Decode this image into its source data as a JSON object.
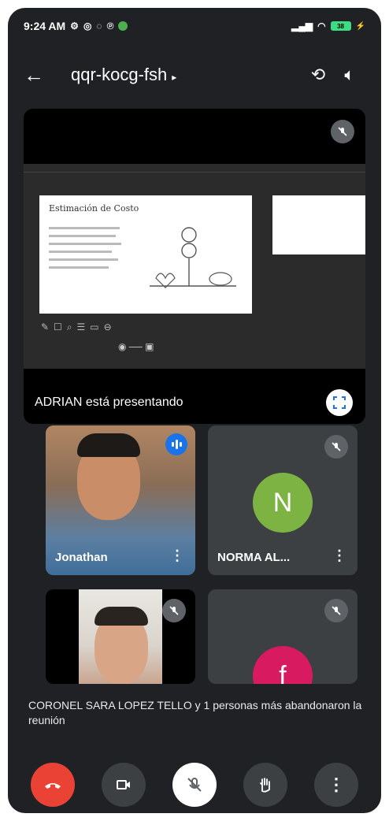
{
  "status_bar": {
    "time": "9:24 AM",
    "notif_icons": [
      "grid-icon",
      "whatsapp-icon",
      "messenger-icon",
      "pinterest-icon",
      "green-app-icon"
    ],
    "battery": "38"
  },
  "header": {
    "meeting_code": "qqr-kocg-fsh",
    "caret": "▸"
  },
  "presentation": {
    "label": "ADRIAN está presentando",
    "slide_title": "Estimación de Costo"
  },
  "participants": [
    {
      "name": "Jonathan",
      "speaking": true
    },
    {
      "name": "NORMA AL...",
      "initial": "N",
      "color": "#7cb342",
      "muted": true
    },
    {
      "name": "",
      "muted": true
    },
    {
      "name": "",
      "initial": "f",
      "color": "#d81b60",
      "muted": true
    }
  ],
  "notice": "CORONEL SARA LOPEZ TELLO y 1 personas más abandonaron la reunión",
  "controls": [
    "end-call",
    "camera",
    "microphone",
    "raise-hand",
    "more-options"
  ]
}
